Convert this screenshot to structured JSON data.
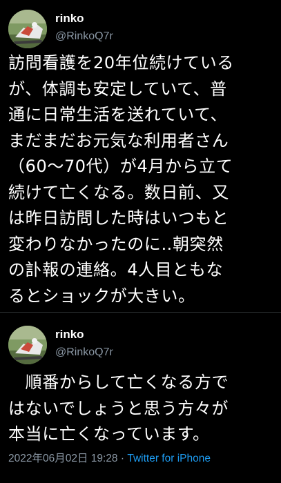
{
  "tweets": [
    {
      "display_name": "rinko",
      "handle": "@RinkoQ7r",
      "lines": [
        "訪問看護を20年位続けている",
        "が、体調も安定していて、普",
        "通に日常生活を送れていて、",
        "まだまだお元気な利用者さん",
        "（60〜70代）が4月から立て",
        "続けて亡くなる。数日前、又",
        "は昨日訪問した時はいつもと",
        "変わりなかったのに‥朝突然",
        "の訃報の連絡。4人目ともな",
        "るとショックが大きい。"
      ]
    },
    {
      "display_name": "rinko",
      "handle": "@RinkoQ7r",
      "lines": [
        "　順番からして亡くなる方で",
        "はないでしょうと思う方々が",
        "本当に亡くなっています。"
      ],
      "timestamp": "2022年06月02日 19:28",
      "separator": "·",
      "source": "Twitter for iPhone"
    }
  ],
  "colors": {
    "background": "#000000",
    "text": "#ffffff",
    "secondary": "#8b98a5",
    "link": "#1d9bf0",
    "divider": "#2f3336"
  },
  "icons": {
    "avatar": "avatar-image"
  }
}
